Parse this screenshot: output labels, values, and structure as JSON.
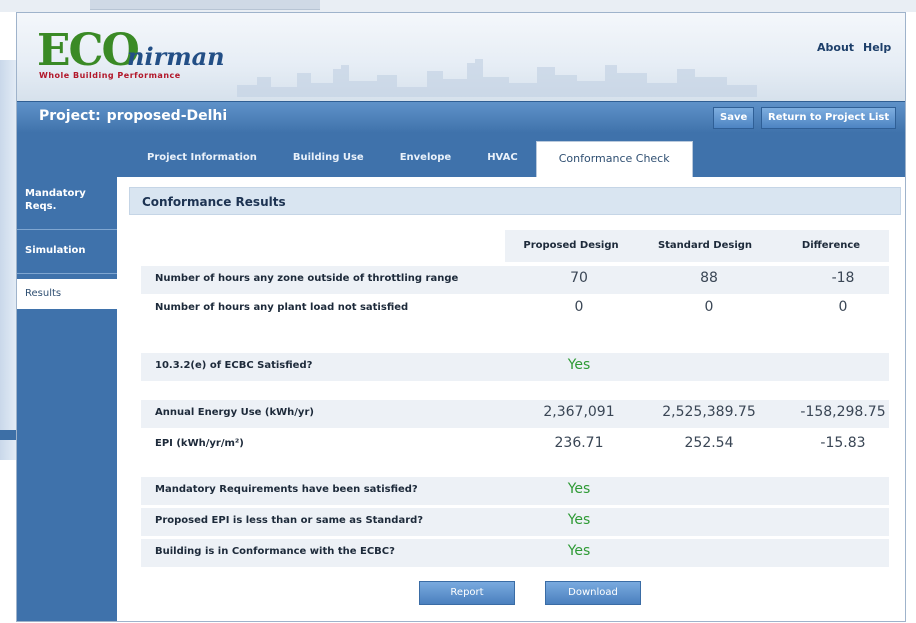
{
  "header": {
    "logo": {
      "eco": "ECO",
      "nirman": "nirman",
      "tagline": "Whole Building Performance"
    },
    "links": {
      "about": "About",
      "help": "Help"
    }
  },
  "project": {
    "label": "Project:",
    "name": "proposed-Delhi",
    "save_label": "Save",
    "return_label": "Return to Project List"
  },
  "tabs": [
    {
      "label": "Project Information"
    },
    {
      "label": "Building Use"
    },
    {
      "label": "Envelope"
    },
    {
      "label": "HVAC"
    },
    {
      "label": "Conformance Check"
    }
  ],
  "sidebar": {
    "items": [
      {
        "label": "Mandatory Reqs."
      },
      {
        "label": "Simulation"
      },
      {
        "label": "Results"
      }
    ]
  },
  "results": {
    "title": "Conformance Results",
    "columns": [
      "Proposed Design",
      "Standard Design",
      "Difference"
    ],
    "rows": [
      {
        "label": "Number of hours any zone outside of throttling range",
        "proposed": "70",
        "standard": "88",
        "difference": "-18"
      },
      {
        "label": "Number of hours any plant load not satisfied",
        "proposed": "0",
        "standard": "0",
        "difference": "0"
      },
      {
        "label": "10.3.2(e) of ECBC Satisfied?",
        "proposed": "Yes"
      },
      {
        "label": "Annual Energy Use (kWh/yr)",
        "proposed": "2,367,091",
        "standard": "2,525,389.75",
        "difference": "-158,298.75"
      },
      {
        "label": "EPI (kWh/yr/m²)",
        "proposed": "236.71",
        "standard": "252.54",
        "difference": "-15.83"
      },
      {
        "label": "Mandatory Requirements have been satisfied?",
        "proposed": "Yes"
      },
      {
        "label": "Proposed EPI is less than or same as Standard?",
        "proposed": "Yes"
      },
      {
        "label": "Building is in Conformance with the ECBC?",
        "proposed": "Yes"
      }
    ],
    "buttons": {
      "report": "Report",
      "download": "Download"
    }
  },
  "colors": {
    "brand_blue": "#3f72ab",
    "logo_green": "#3a8a25",
    "yes_green": "#2e9a35",
    "row_shade": "#edf1f6"
  }
}
